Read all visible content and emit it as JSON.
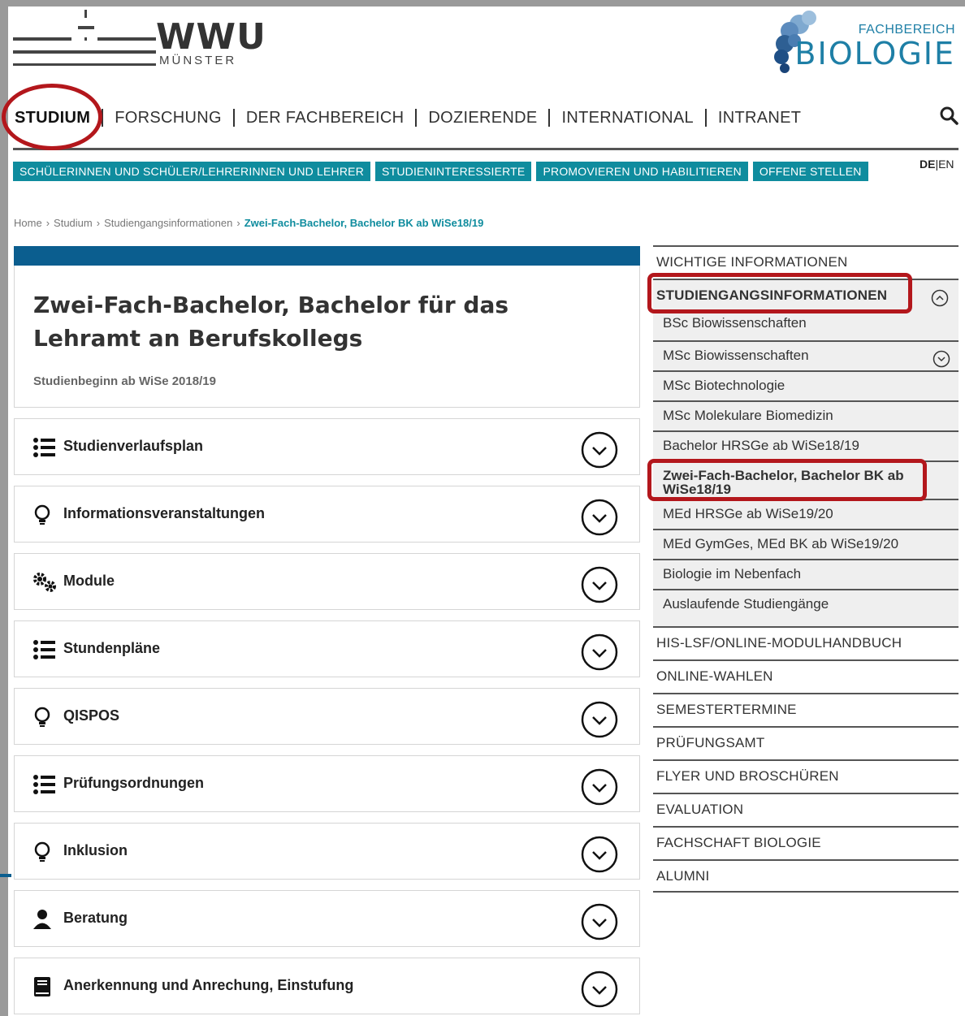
{
  "header": {
    "wwu": {
      "name": "WWU",
      "city": "MÜNSTER"
    },
    "fachbereich": {
      "small": "FACHBEREICH",
      "big": "BIOLOGIE"
    }
  },
  "mainnav": [
    "STUDIUM",
    "FORSCHUNG",
    "DER FACHBEREICH",
    "DOZIERENDE",
    "INTERNATIONAL",
    "INTRANET"
  ],
  "subnav": [
    "SCHÜLERINNEN UND SCHÜLER/LEHRERINNEN UND LEHRER",
    "STUDIENINTERESSIERTE",
    "PROMOVIEREN UND HABILITIEREN",
    "OFFENE STELLEN"
  ],
  "lang": {
    "de": "DE",
    "sep": "|",
    "en": "EN"
  },
  "breadcrumb": [
    "Home",
    "Studium",
    "Studiengangsinformationen",
    "Zwei-Fach-Bachelor, Bachelor BK ab WiSe18/19"
  ],
  "breadcrumb_sep": "›",
  "page": {
    "title": "Zwei-Fach-Bachelor, Bachelor für das Lehramt an Berufskollegs",
    "subtitle": "Studienbeginn ab WiSe 2018/19"
  },
  "accordion": [
    {
      "label": "Studienverlaufsplan",
      "icon": "list-icon"
    },
    {
      "label": "Informationsveranstaltungen",
      "icon": "lightbulb-icon"
    },
    {
      "label": "Module",
      "icon": "gears-icon"
    },
    {
      "label": "Stundenpläne",
      "icon": "list-icon"
    },
    {
      "label": "QISPOS",
      "icon": "lightbulb-icon"
    },
    {
      "label": "Prüfungsordnungen",
      "icon": "list-icon"
    },
    {
      "label": "Inklusion",
      "icon": "lightbulb-icon"
    },
    {
      "label": "Beratung",
      "icon": "user-icon"
    },
    {
      "label": "Anerkennung und Anrechung, Einstufung",
      "icon": "book-icon"
    }
  ],
  "sidebar": {
    "wichtige": "WICHTIGE INFORMATIONEN",
    "studiengang": "STUDIENGANGSINFORMATIONEN",
    "sub": [
      "BSc Biowissenschaften",
      "MSc Biowissenschaften",
      "MSc Biotechnologie",
      "MSc Molekulare Biomedizin",
      "Bachelor HRSGe ab WiSe18/19",
      "Zwei-Fach-Bachelor, Bachelor BK ab WiSe18/19",
      "MEd HRSGe ab WiSe19/20",
      "MEd GymGes, MEd BK ab WiSe19/20",
      "Biologie im Nebenfach",
      "Auslaufende Studiengänge"
    ],
    "rest": [
      "HIS-LSF/ONLINE-MODULHANDBUCH",
      "ONLINE-WAHLEN",
      "SEMESTERTERMINE",
      "PRÜFUNGSAMT",
      "FLYER UND BROSCHÜREN",
      "EVALUATION",
      "FACHSCHAFT BIOLOGIE",
      "ALUMNI"
    ]
  },
  "colors": {
    "teal": "#0f8c9e",
    "navy": "#0b5e8f",
    "annotation": "#b3171c"
  }
}
